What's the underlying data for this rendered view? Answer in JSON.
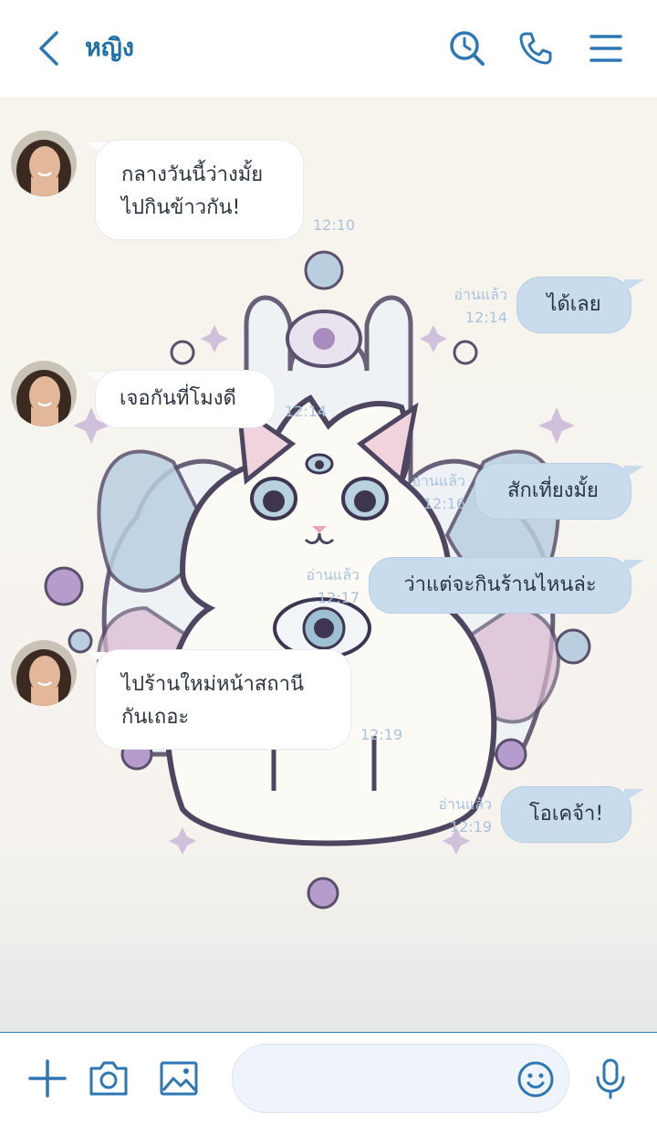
{
  "header": {
    "title": "หญิง",
    "icons": [
      "back-arrow-icon",
      "search-history-icon",
      "phone-icon",
      "menu-icon"
    ]
  },
  "colors": {
    "accent": "#2d77b5",
    "out_bubble": "#c9dcee",
    "meta_text": "#a9c3dc"
  },
  "messages": [
    {
      "dir": "in",
      "lines": [
        "กลางวันนี้ว่างมั้ย",
        "ไปกินข้าวกัน!"
      ],
      "time": "12:10"
    },
    {
      "dir": "out",
      "text": "ได้เลย",
      "read": "อ่านแล้ว",
      "time": "12:14"
    },
    {
      "dir": "in",
      "lines": [
        "เจอกันที่โมงดี"
      ],
      "time": "12:14"
    },
    {
      "dir": "out",
      "text": "สักเที่ยงมั้ย",
      "read": "อ่านแล้ว",
      "time": "12:16"
    },
    {
      "dir": "out",
      "text": "ว่าแต่จะกินร้านไหนล่ะ",
      "read": "อ่านแล้ว",
      "time": "12:17"
    },
    {
      "dir": "in",
      "lines": [
        "ไปร้านใหม่หน้าสถานี",
        "กันเถอะ"
      ],
      "time": "12:19"
    },
    {
      "dir": "out",
      "text": "โอเคจ้า!",
      "read": "อ่านแล้ว",
      "time": "12:19"
    }
  ],
  "input": {
    "placeholder": "",
    "icons": [
      "plus-icon",
      "camera-icon",
      "image-icon",
      "emoji-icon",
      "microphone-icon"
    ]
  }
}
